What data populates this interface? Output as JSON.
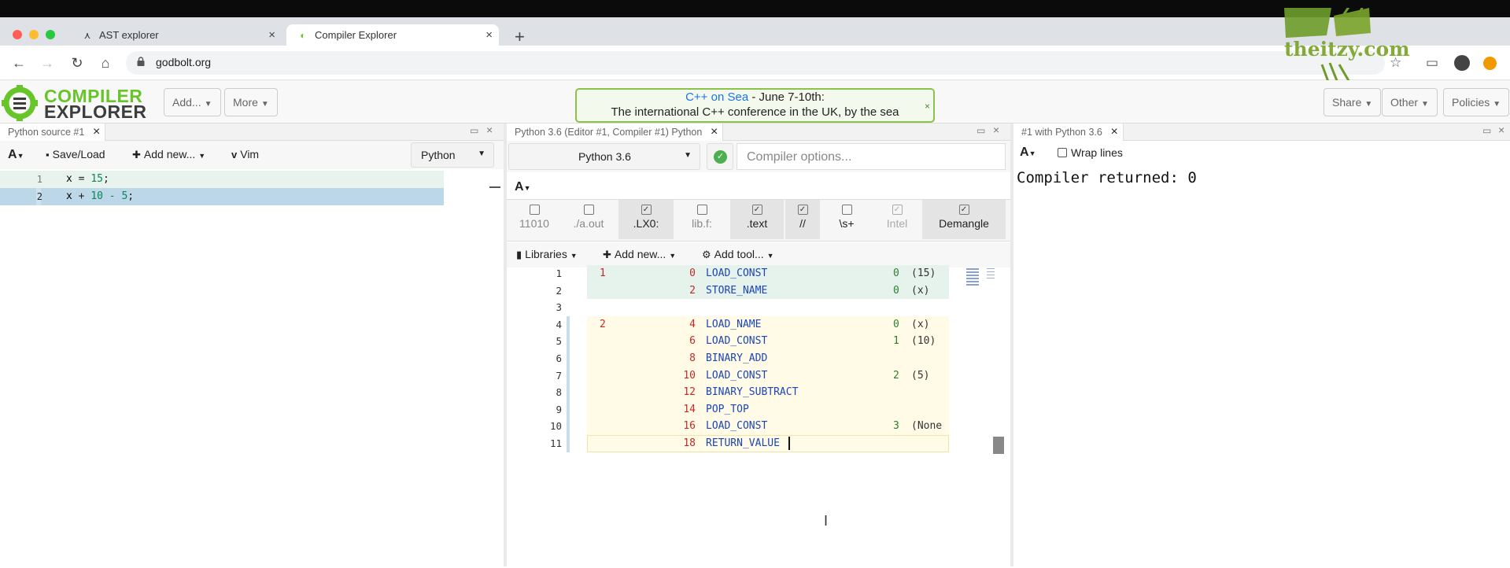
{
  "browser": {
    "tabs": [
      {
        "title": "AST explorer",
        "active": false
      },
      {
        "title": "Compiler Explorer",
        "active": true
      }
    ],
    "url": "godbolt.org",
    "traffic_colors": [
      "#ff5f57",
      "#febc2e",
      "#28c840"
    ]
  },
  "watermark": {
    "text": "theitzy.com",
    "color": "#7aa32a"
  },
  "header": {
    "logo_line1": "COMPILER",
    "logo_line2": "EXPLORER",
    "add_label": "Add...",
    "more_label": "More",
    "banner_link": "C++ on Sea",
    "banner_rest": " - June 7-10th:",
    "banner_line2": "The international C++ conference in the UK, by the sea",
    "banner_close": "×",
    "share_label": "Share",
    "other_label": "Other",
    "policies_label": "Policies"
  },
  "left_pane": {
    "tab_title": "Python source #1",
    "font_btn": "A",
    "saveload": "Save/Load",
    "addnew": "Add new...",
    "vim": "Vim",
    "language": "Python",
    "lines": [
      {
        "num": "1",
        "var": "x",
        "mid": " = ",
        "num_token": "15",
        "end": ";"
      },
      {
        "num": "2",
        "var": "x",
        "mid": " + ",
        "num_token": "10 - 5",
        "end": ";"
      }
    ]
  },
  "middle_pane": {
    "tab_title": "Python 3.6 (Editor #1, Compiler #1) Python",
    "compiler": "Python 3.6",
    "compiler_options_placeholder": "Compiler options...",
    "font_btn": "A",
    "options": [
      {
        "label": "11010",
        "checked": false
      },
      {
        "label": "./a.out",
        "checked": false
      },
      {
        "label": ".LX0:",
        "checked": true
      },
      {
        "label": "lib.f:",
        "checked": false
      },
      {
        "label": ".text",
        "checked": true
      },
      {
        "label": "//",
        "checked": true
      },
      {
        "label": "\\s+",
        "checked": false
      },
      {
        "label": "Intel",
        "checked": true
      },
      {
        "label": "Demangle",
        "checked": true
      }
    ],
    "libraries": "Libraries",
    "addnew": "Add new...",
    "addtool": "Add tool...",
    "asm": [
      {
        "ln": "1",
        "src": "1",
        "off": "0",
        "op": "LOAD_CONST",
        "arg": "0",
        "val": "(15)"
      },
      {
        "ln": "2",
        "src": "",
        "off": "2",
        "op": "STORE_NAME",
        "arg": "0",
        "val": "(x)"
      },
      {
        "ln": "3",
        "src": "",
        "off": "",
        "op": "",
        "arg": "",
        "val": ""
      },
      {
        "ln": "4",
        "src": "2",
        "off": "4",
        "op": "LOAD_NAME",
        "arg": "0",
        "val": "(x)"
      },
      {
        "ln": "5",
        "src": "",
        "off": "6",
        "op": "LOAD_CONST",
        "arg": "1",
        "val": "(10)"
      },
      {
        "ln": "6",
        "src": "",
        "off": "8",
        "op": "BINARY_ADD",
        "arg": "",
        "val": ""
      },
      {
        "ln": "7",
        "src": "",
        "off": "10",
        "op": "LOAD_CONST",
        "arg": "2",
        "val": "(5)"
      },
      {
        "ln": "8",
        "src": "",
        "off": "12",
        "op": "BINARY_SUBTRACT",
        "arg": "",
        "val": ""
      },
      {
        "ln": "9",
        "src": "",
        "off": "14",
        "op": "POP_TOP",
        "arg": "",
        "val": ""
      },
      {
        "ln": "10",
        "src": "",
        "off": "16",
        "op": "LOAD_CONST",
        "arg": "3",
        "val": "(None"
      },
      {
        "ln": "11",
        "src": "",
        "off": "18",
        "op": "RETURN_VALUE",
        "arg": "",
        "val": ""
      }
    ]
  },
  "right_pane": {
    "tab_title": "#1 with Python 3.6",
    "font_btn": "A",
    "wrap_lines": "Wrap lines",
    "output": "Compiler returned: 0"
  }
}
